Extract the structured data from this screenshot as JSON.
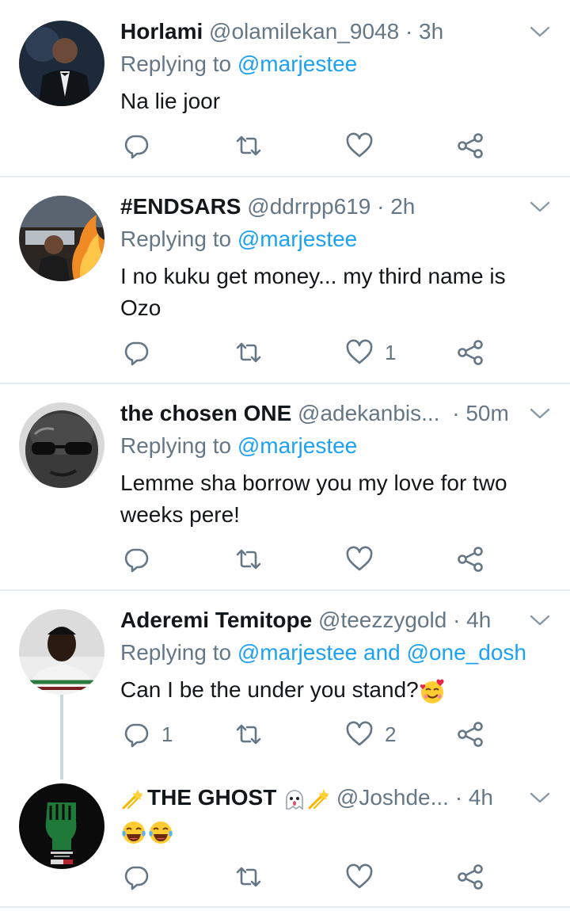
{
  "tweets": [
    {
      "name": "Horlami",
      "handle": "@olamilekan_9048",
      "time": "· 3h",
      "replying_prefix": "Replying to ",
      "replying_to": "@marjestee",
      "text": "Na lie joor",
      "reply_count": "",
      "like_count": ""
    },
    {
      "name": "#ENDSARS",
      "handle": "@ddrrpp619",
      "time": "· 2h",
      "replying_prefix": "Replying to ",
      "replying_to": "@marjestee",
      "text": "I no kuku get money... my third name is Ozo",
      "reply_count": "",
      "like_count": "1"
    },
    {
      "name": "the chosen ONE",
      "handle": "@adekanbis...",
      "time": "· 50m",
      "replying_prefix": "Replying to ",
      "replying_to": "@marjestee",
      "text": "Lemme sha borrow you my love for two weeks pere!",
      "reply_count": "",
      "like_count": ""
    },
    {
      "name": "Aderemi Temitope",
      "handle": "@teezzygold",
      "time": "· 4h",
      "replying_prefix": "Replying to ",
      "replying_to": "@marjestee",
      "replying_and": " and ",
      "replying_to_2": "@one_dosh",
      "text": "Can I be the under you stand?",
      "reply_count": "1",
      "like_count": "2"
    },
    {
      "name": "THE GHOST",
      "handle": "@Joshde...",
      "time": "· 4h",
      "text": "",
      "reply_count": "",
      "like_count": ""
    }
  ],
  "icons": {
    "reply": "reply-icon",
    "retweet": "retweet-icon",
    "like": "heart-icon",
    "share": "share-icon",
    "menu": "chevron-down-icon"
  },
  "colors": {
    "link": "#1da1f2",
    "secondary": "#657786",
    "divider": "#e6ecf0"
  }
}
